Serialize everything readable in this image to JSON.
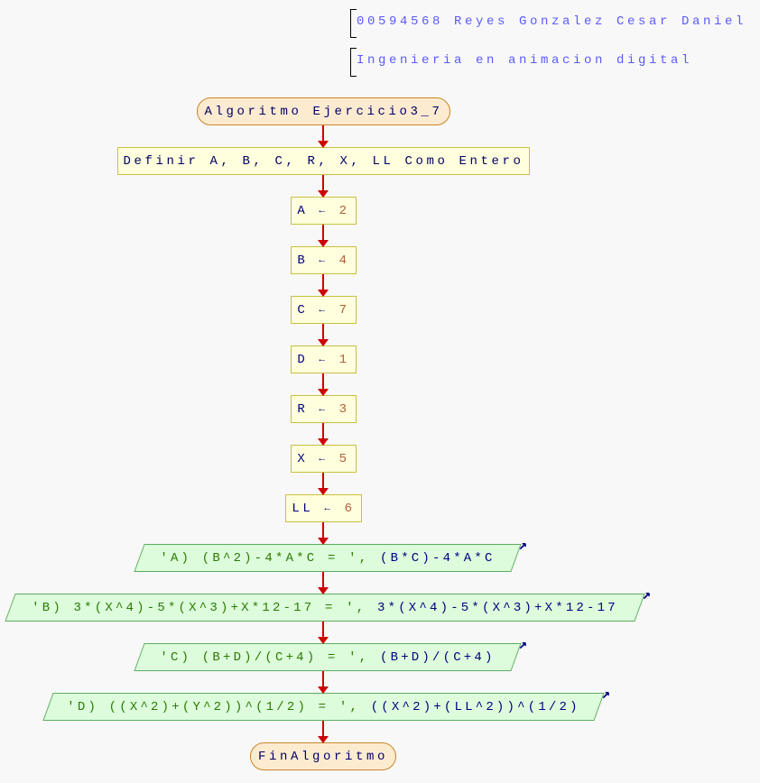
{
  "header": {
    "student": "00594568 Reyes Gonzalez Cesar Daniel",
    "career": "Ingenieria en animacion digital"
  },
  "flowchart": {
    "start": "Algoritmo Ejercicio3_7",
    "define": "Definir A, B, C, R, X, LL Como Entero",
    "assignments": [
      {
        "var": "A",
        "arrow": "←",
        "value": "2"
      },
      {
        "var": "B",
        "arrow": "←",
        "value": "4"
      },
      {
        "var": "C",
        "arrow": "←",
        "value": "7"
      },
      {
        "var": "D",
        "arrow": "←",
        "value": "1"
      },
      {
        "var": "R",
        "arrow": "←",
        "value": "3"
      },
      {
        "var": "X",
        "arrow": "←",
        "value": "5"
      },
      {
        "var": "LL",
        "arrow": "←",
        "value": "6"
      }
    ],
    "outputs": [
      {
        "string": "'A) (B^2)-4*A*C = ',",
        "expr": "(B*C)-4*A*C"
      },
      {
        "string": "'B) 3*(X^4)-5*(X^3)+X*12-17 = ',",
        "expr": "3*(X^4)-5*(X^3)+X*12-17"
      },
      {
        "string": "'C) (B+D)/(C+4) = ',",
        "expr": "(B+D)/(C+4)"
      },
      {
        "string": "'D) ((X^2)+(Y^2))^(1/2) = ',",
        "expr": "((X^2)+(LL^2))^(1/2)"
      }
    ],
    "end": "FinAlgoritmo"
  },
  "colors": {
    "string": "#2d7a00",
    "number": "#b0603a",
    "identifier": "#000080",
    "arrow": "#cc0000"
  }
}
